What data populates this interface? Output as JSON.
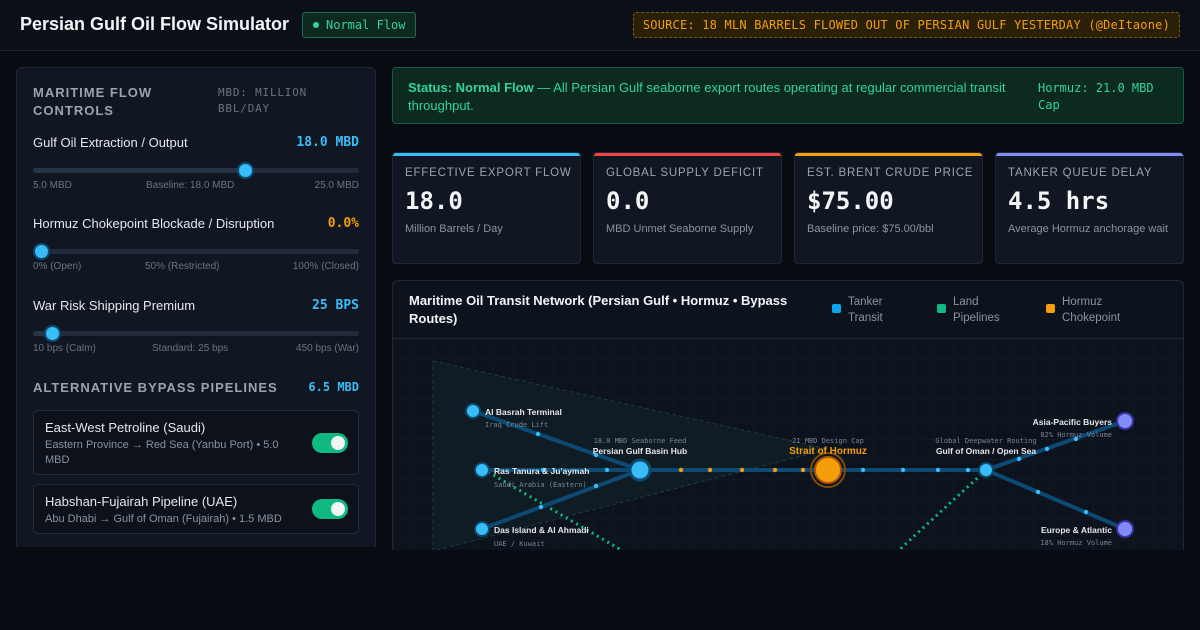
{
  "app": {
    "title": "Persian Gulf Oil Flow Simulator",
    "mode_badge": "Normal Flow",
    "source_note": "SOURCE: 18 MLN BARRELS FLOWED OUT OF PERSIAN GULF YESTERDAY (@DeItaone)"
  },
  "controls": {
    "heading": "Maritime Flow Controls",
    "unit_note": "MBD: Million bbl/day",
    "sliders": [
      {
        "label": "Gulf Oil Extraction / Output",
        "value_text": "18.0 MBD",
        "color": "#38bdf8",
        "position": 0.65,
        "ticks": [
          "5.0 MBD",
          "Baseline: 18.0 MBD",
          "25.0 MBD"
        ]
      },
      {
        "label": "Hormuz Chokepoint Blockade / Disruption",
        "value_text": "0.0%",
        "color": "#f59e0b",
        "position": 0.0,
        "ticks": [
          "0% (Open)",
          "50% (Restricted)",
          "100% (Closed)"
        ]
      },
      {
        "label": "War Risk Shipping Premium",
        "value_text": "25 BPS",
        "color": "#38bdf8",
        "position": 0.035,
        "ticks": [
          "10 bps (Calm)",
          "Standard: 25 bps",
          "450 bps (War)"
        ]
      }
    ],
    "bypass_heading": "Alternative Bypass Pipelines",
    "bypass_total": "6.5 MBD",
    "pipelines": [
      {
        "name": "East-West Petroline (Saudi)",
        "route": "Eastern Province → Red Sea (Yanbu Port) • 5.0 MBD",
        "enabled": true
      },
      {
        "name": "Habshan-Fujairah Pipeline (UAE)",
        "route": "Abu Dhabi → Gulf of Oman (Fujairah) • 1.5 MBD",
        "enabled": true
      }
    ]
  },
  "status": {
    "label": "Status: Normal Flow",
    "text": " — All Persian Gulf seaborne export routes operating at regular commercial transit throughput.",
    "cap": "Hormuz: 21.0 MBD Cap"
  },
  "kpis": [
    {
      "label": "Effective Export Flow",
      "value": "18.0",
      "sub": "Million Barrels / Day",
      "color": "#38bdf8"
    },
    {
      "label": "Global Supply Deficit",
      "value": "0.0",
      "sub": "MBD Unmet Seaborne Supply",
      "color": "#ef4444"
    },
    {
      "label": "Est. Brent Crude Price",
      "value": "$75.00",
      "sub": "Baseline price: $75.00/bbl",
      "color": "#f59e0b"
    },
    {
      "label": "Tanker Queue Delay",
      "value": "4.5 hrs",
      "sub": "Average Hormuz anchorage wait",
      "color": "#818cf8"
    }
  ],
  "map": {
    "title": "Maritime Oil Transit Network (Persian Gulf • Hormuz • Bypass Routes)",
    "legend": [
      {
        "label": "Tanker Transit",
        "color": "#0ea5e9"
      },
      {
        "label": "Land Pipelines",
        "color": "#10b981"
      },
      {
        "label": "Hormuz Chokepoint",
        "color": "#f59e0b"
      }
    ],
    "nodes": {
      "basra": {
        "name": "Al Basrah Terminal",
        "sub": "Iraq Crude Lift"
      },
      "ras_tanura": {
        "name": "Ras Tanura & Ju'aymah",
        "sub": "Saudi Arabia (Eastern)"
      },
      "das_island": {
        "name": "Das Island & Al Ahmadi",
        "sub": "UAE / Kuwait"
      },
      "hub": {
        "name": "Persian Gulf Basin Hub",
        "sub": "18.0 MBD Seaborne Feed"
      },
      "hormuz": {
        "name": "Strait of Hormuz",
        "sub": "21 MBD Design Cap"
      },
      "oman": {
        "name": "Gulf of Oman / Open Sea",
        "sub": "Global Deepwater Routing"
      },
      "asia": {
        "name": "Asia-Pacific Buyers",
        "sub": "82% Hormuz Volume"
      },
      "europe": {
        "name": "Europe & Atlantic",
        "sub": "18% Hormuz Volume"
      }
    }
  }
}
